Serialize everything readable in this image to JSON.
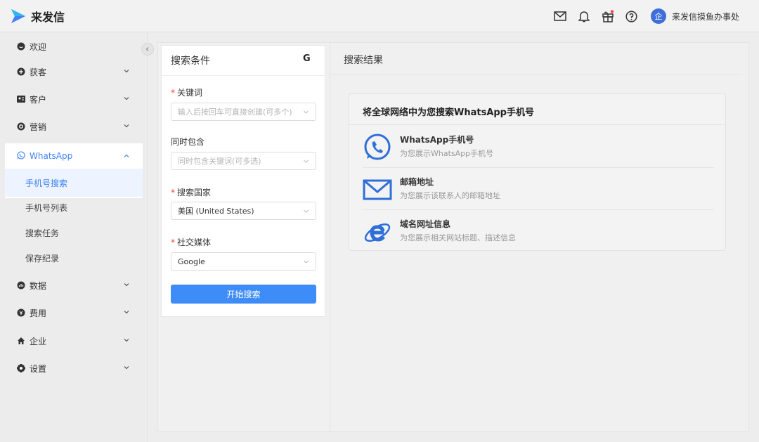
{
  "app": {
    "name": "来发信",
    "user_avatar": "企",
    "user_name": "来发信摸鱼办事处",
    "accent_color": "#3e82f7"
  },
  "topbar_icons": [
    "mail-icon",
    "bell-icon",
    "gift-icon",
    "help-icon"
  ],
  "sidebar": {
    "items": [
      {
        "label": "欢迎",
        "icon": "smile-icon"
      },
      {
        "label": "获客",
        "icon": "plus-circle-icon"
      },
      {
        "label": "客户",
        "icon": "id-card-icon"
      },
      {
        "label": "营销",
        "icon": "target-icon"
      },
      {
        "label": "WhatsApp",
        "icon": "whatsapp-icon"
      },
      {
        "label": "数据",
        "icon": "chart-icon"
      },
      {
        "label": "费用",
        "icon": "coin-icon"
      },
      {
        "label": "企业",
        "icon": "home-icon"
      },
      {
        "label": "设置",
        "icon": "gear-icon"
      }
    ],
    "whatsapp_sub": [
      "手机号搜索",
      "手机号列表",
      "搜索任务",
      "保存纪录"
    ]
  },
  "search_panel": {
    "title": "搜索条件",
    "engine_badge": "G",
    "keyword_label": "关键词",
    "keyword_placeholder": "输入后按回车可直接创建(可多个)",
    "include_label": "同时包含",
    "include_placeholder": "同时包含关键词(可多选)",
    "country_label": "搜索国家",
    "country_value": "美国 (United States)",
    "media_label": "社交媒体",
    "media_value": "Google",
    "start_button": "开始搜索"
  },
  "results": {
    "title": "搜索结果",
    "card_title": "将全球网络中为您搜索WhatsApp手机号",
    "features": [
      {
        "title": "WhatsApp手机号",
        "desc": "为您展示WhatsApp手机号",
        "icon": "whatsapp-icon"
      },
      {
        "title": "邮箱地址",
        "desc": "为您展示该联系人的邮箱地址",
        "icon": "mail-icon"
      },
      {
        "title": "域名网址信息",
        "desc": "为您展示相关网站标题、描述信息",
        "icon": "ie-browser-icon"
      }
    ]
  }
}
